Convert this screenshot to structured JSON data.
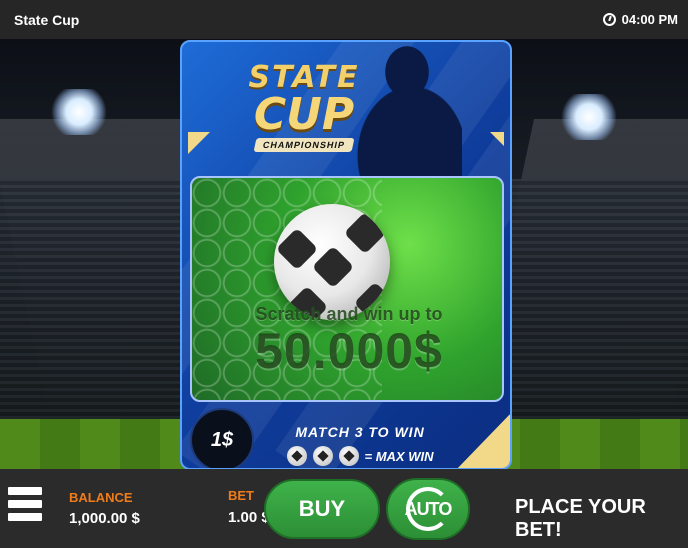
{
  "app": {
    "title": "State Cup",
    "time": "04:00 PM"
  },
  "ticket": {
    "logo": {
      "line1": "STATE",
      "line2": "CUP",
      "badge": "CHAMPIONSHIP"
    },
    "promo_line1": "Scratch and win up to",
    "promo_line2": "50.000$",
    "price": "1$",
    "rule_match": "MATCH 3 TO WIN",
    "rule_max": "= MAX WIN"
  },
  "bottombar": {
    "balance_label": "BALANCE",
    "balance_value": "1,000.00 $",
    "bet_label": "BET",
    "bet_value": "1.00 $",
    "buy_label": "BUY",
    "auto_label": "AUTO",
    "status_text": "PLACE YOUR BET!"
  },
  "icons": {
    "clock": "clock-icon",
    "menu": "hamburger-menu-icon",
    "auto": "refresh-cycle-icon",
    "ball": "soccer-ball-icon"
  },
  "colors": {
    "topbar": "#262626",
    "bottombar": "#2b2b2b",
    "label_accent": "#f07c18",
    "button_green": "#3fb24a",
    "ticket_blue": "#1e6cd8",
    "logo_gold": "#f5d77a"
  }
}
